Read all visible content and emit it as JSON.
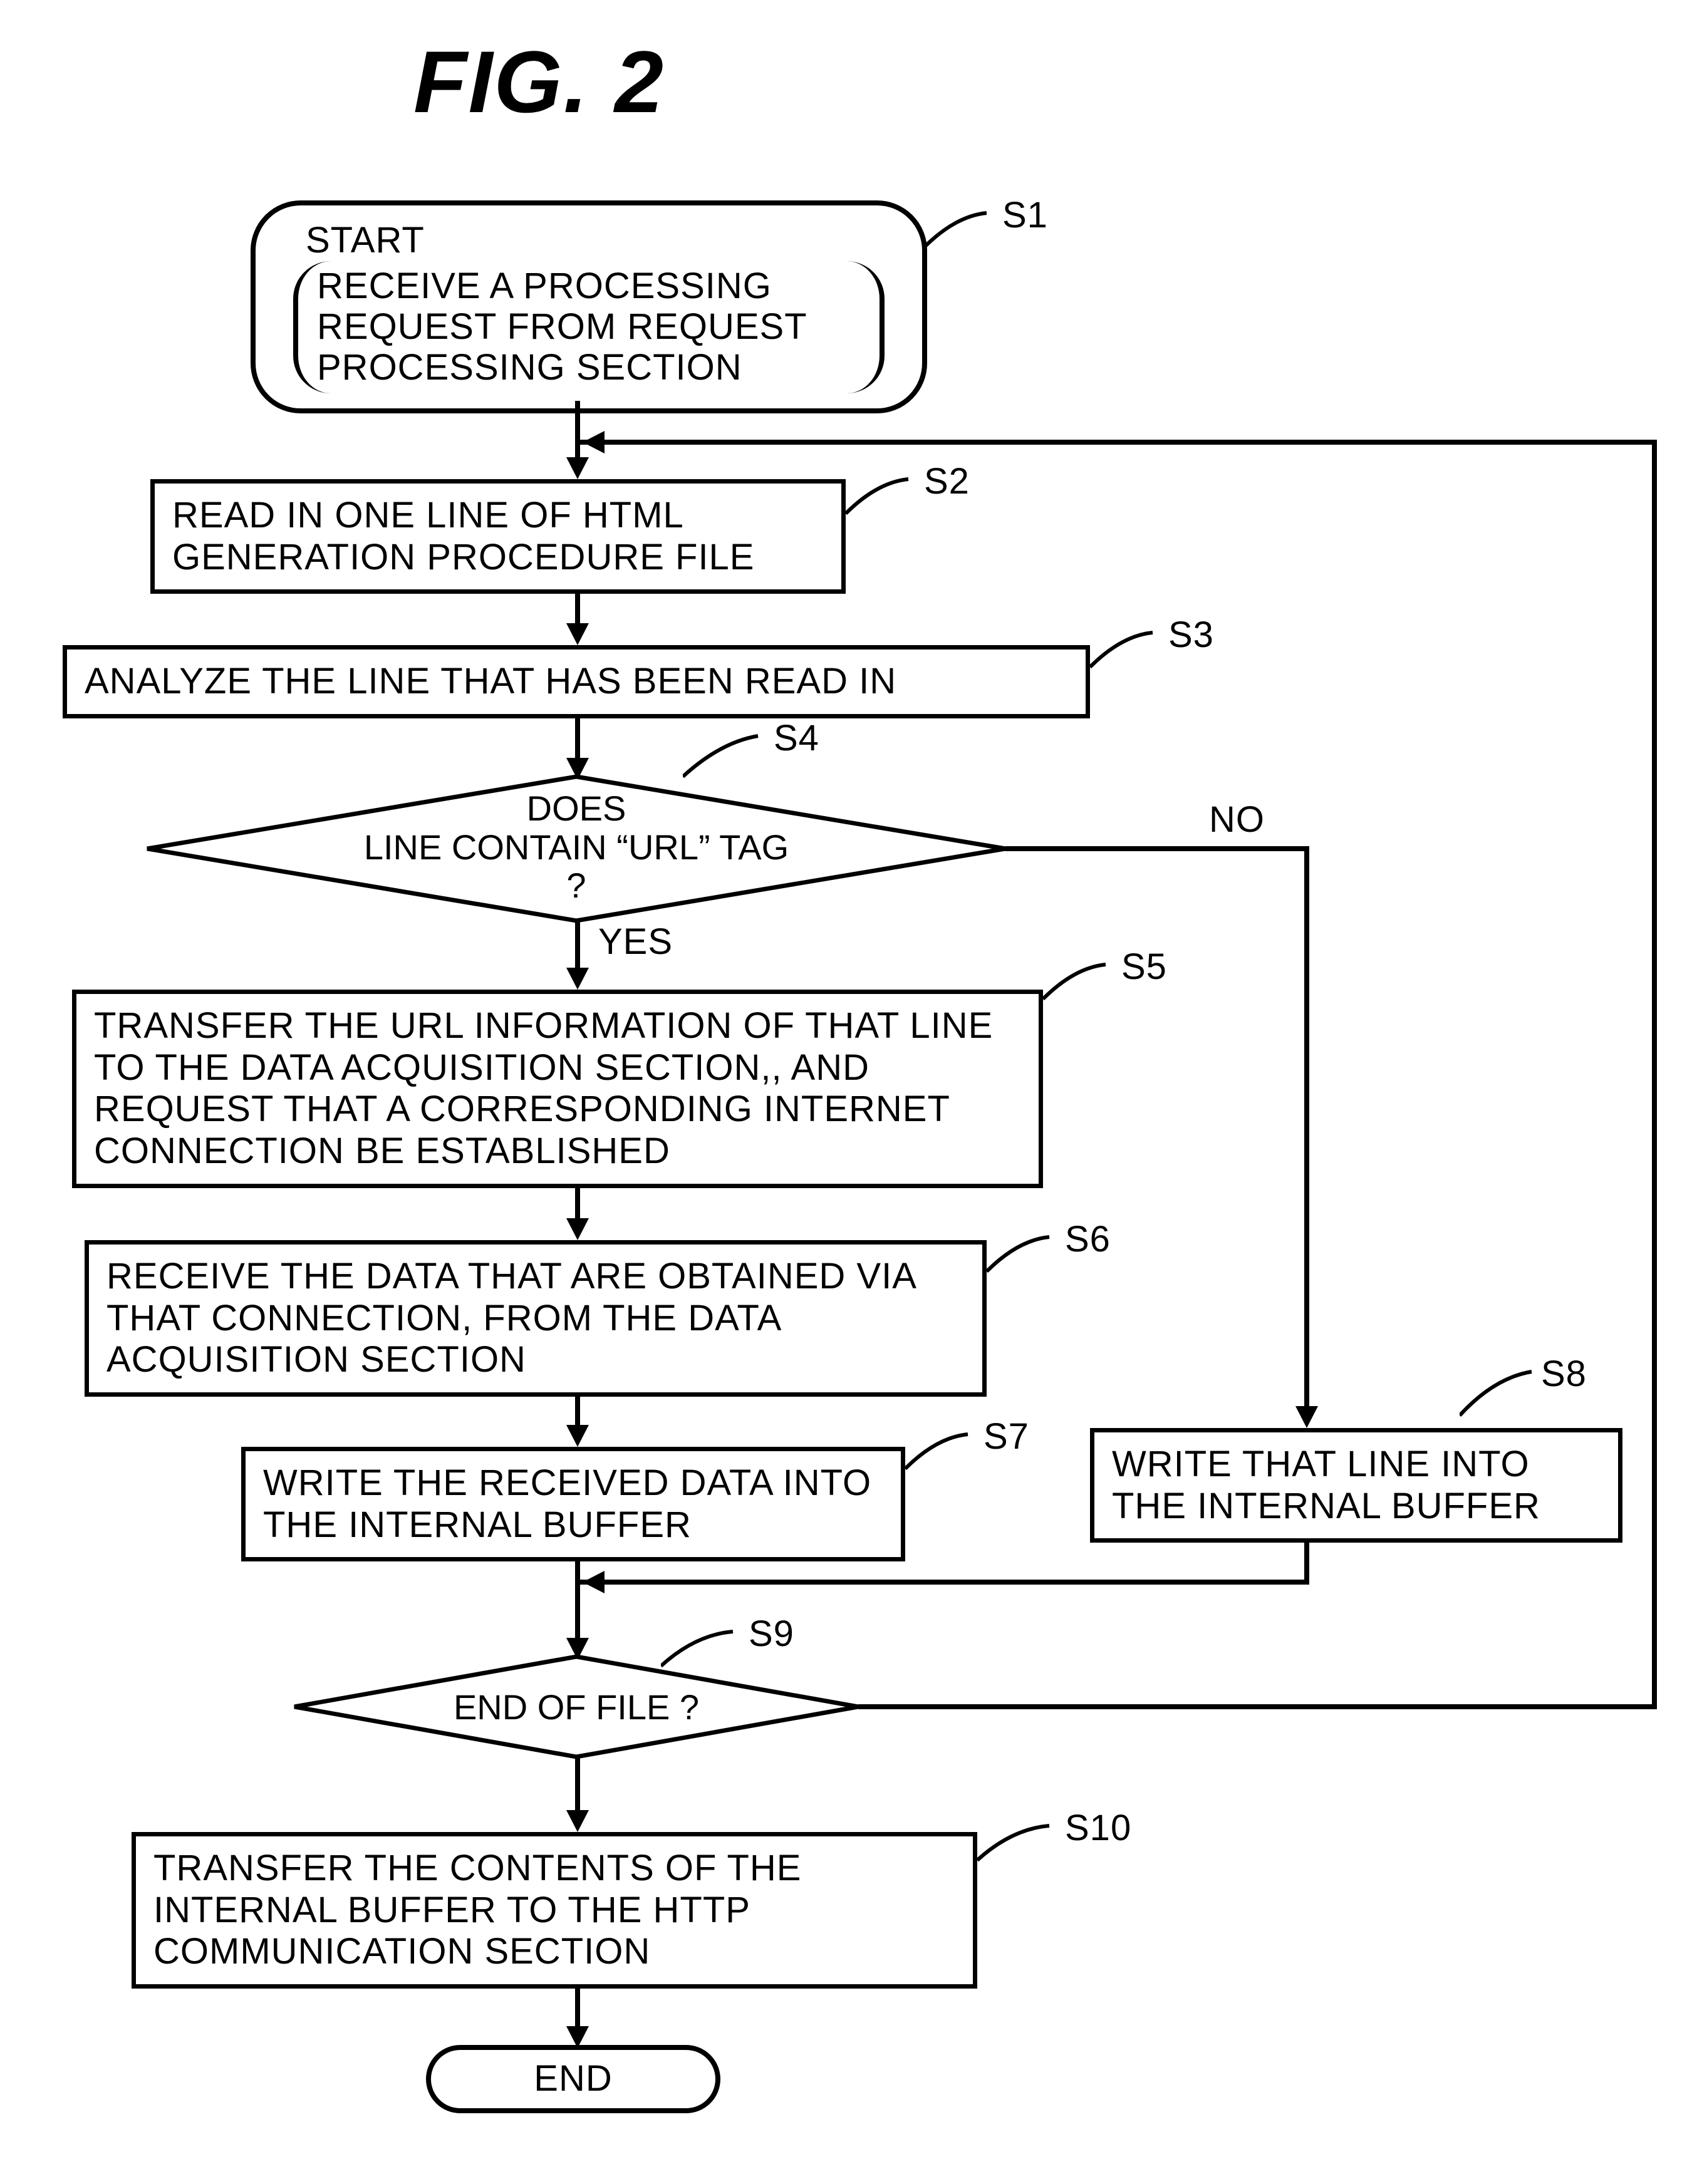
{
  "title": "FIG. 2",
  "nodes": {
    "s1": {
      "id": "S1",
      "lines": [
        "START",
        "RECEIVE A PROCESSING",
        "REQUEST FROM REQUEST",
        "PROCESSING SECTION"
      ]
    },
    "s2": {
      "id": "S2",
      "text": "READ IN ONE LINE OF HTML GENERATION PROCEDURE FILE"
    },
    "s3": {
      "id": "S3",
      "text": "ANALYZE THE LINE THAT HAS BEEN READ IN"
    },
    "s4": {
      "id": "S4",
      "text": "DOES\nLINE CONTAIN “URL” TAG\n?"
    },
    "s5": {
      "id": "S5",
      "text": "TRANSFER THE URL INFORMATION OF THAT LINE TO THE DATA ACQUISITION SECTION,, AND REQUEST THAT A CORRESPONDING INTERNET CONNECTION BE ESTABLISHED"
    },
    "s6": {
      "id": "S6",
      "text": "RECEIVE THE DATA THAT ARE OBTAINED VIA THAT CONNECTION, FROM THE DATA ACQUISITION SECTION"
    },
    "s7": {
      "id": "S7",
      "text": "WRITE THE RECEIVED DATA INTO THE INTERNAL BUFFER"
    },
    "s8": {
      "id": "S8",
      "text": "WRITE THAT LINE INTO THE INTERNAL BUFFER"
    },
    "s9": {
      "id": "S9",
      "text": "END OF FILE ?"
    },
    "s10": {
      "id": "S10",
      "text": "TRANSFER THE CONTENTS OF THE INTERNAL BUFFER TO THE HTTP COMMUNICATION SECTION"
    },
    "end": {
      "text": "END"
    }
  },
  "branches": {
    "yes": "YES",
    "no": "NO"
  }
}
